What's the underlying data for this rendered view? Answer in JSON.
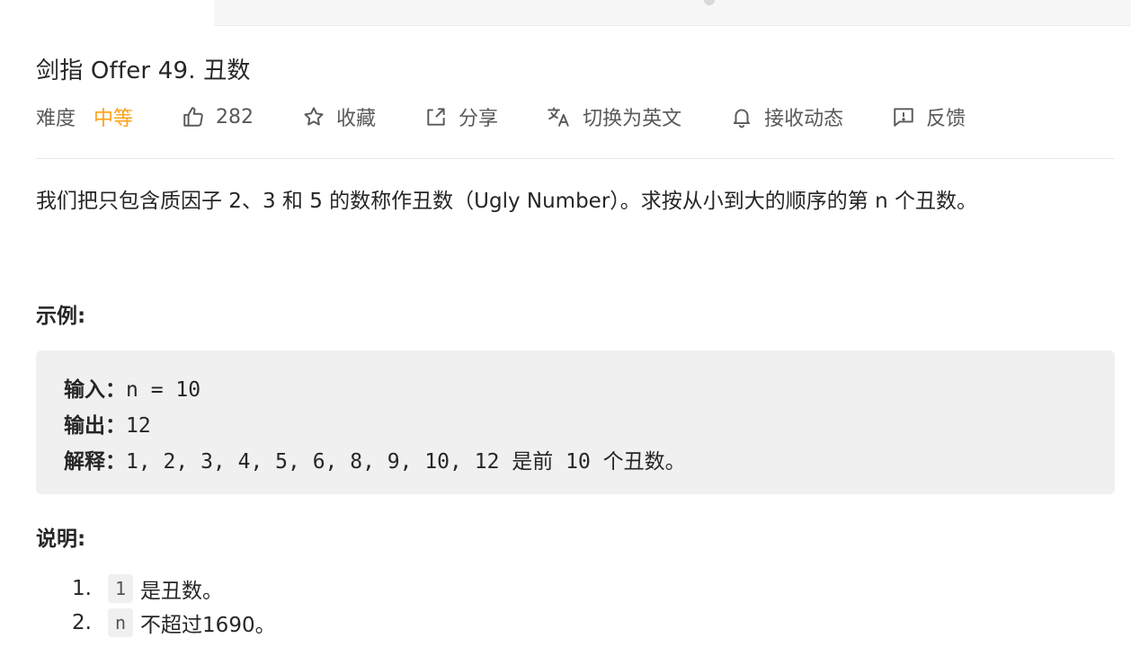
{
  "problem": {
    "title": "剑指 Offer 49. 丑数",
    "difficulty_label": "难度",
    "difficulty_value": "中等",
    "likes": "282",
    "collect_label": "收藏",
    "share_label": "分享",
    "translate_label": "切换为英文",
    "subscribe_label": "接收动态",
    "feedback_label": "反馈",
    "description": "我们把只包含质因子 2、3 和 5 的数称作丑数（Ugly Number）。求按从小到大的顺序的第 n 个丑数。",
    "example_label": "示例:",
    "example": {
      "input_label": "输入：",
      "input_value": "n = 10",
      "output_label": "输出：",
      "output_value": "12",
      "explain_label": "解释：",
      "explain_value": "1, 2, 3, 4, 5, 6, 8, 9, 10, 12 是前 10 个丑数。"
    },
    "notes_label": "说明:",
    "notes": [
      {
        "num": "1.",
        "code": "1",
        "text": "是丑数。"
      },
      {
        "num": "2.",
        "code": "n",
        "text": "不超过1690。"
      }
    ]
  },
  "colors": {
    "difficulty_medium": "#ffa116",
    "text": "#262626",
    "muted": "#595959",
    "code_bg": "#f0f0f0"
  }
}
